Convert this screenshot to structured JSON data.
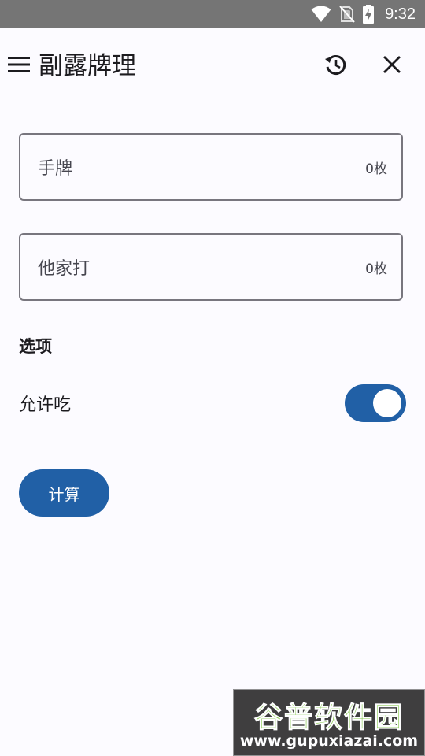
{
  "status_bar": {
    "time": "9:32",
    "icons": [
      "wifi-icon",
      "no-sim-icon",
      "battery-charging-icon"
    ]
  },
  "app_bar": {
    "title": "副露牌理",
    "icons": [
      "menu-icon",
      "history-icon",
      "close-icon"
    ]
  },
  "fields": {
    "hand": {
      "label": "手牌",
      "suffix": "0枚"
    },
    "discard": {
      "label": "他家打",
      "suffix": "0枚"
    }
  },
  "options": {
    "section_title": "选项",
    "allow_chi": {
      "label": "允许吃",
      "enabled": true
    }
  },
  "actions": {
    "calculate_label": "计算"
  },
  "colors": {
    "primary": "#2160a6",
    "background": "#fcfbff",
    "status_bar": "#757575",
    "outline": "#78767e"
  },
  "watermark": {
    "title": "谷普软件园",
    "url": "www.gupuxiazai.com"
  }
}
